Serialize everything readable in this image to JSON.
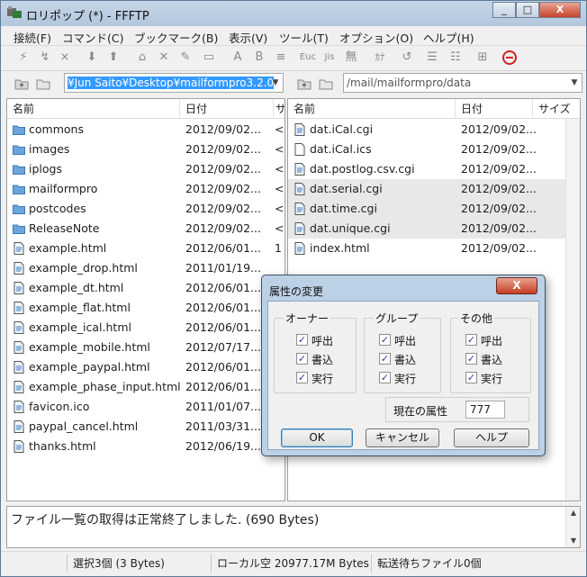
{
  "window": {
    "title": "ロリポップ (*) - FFFTP",
    "minimize_label": "_",
    "maximize_label": "□",
    "close_label": "X"
  },
  "menu": {
    "items": [
      "接続(F)",
      "コマンド(C)",
      "ブックマーク(B)",
      "表示(V)",
      "ツール(T)",
      "オプション(O)",
      "ヘルプ(H)"
    ]
  },
  "toolbar": {
    "icons": [
      "connect-icon",
      "quick-connect-icon",
      "disconnect-icon",
      "download-icon",
      "upload-icon",
      "home-icon",
      "delete-icon",
      "rename-icon",
      "mkdir-icon",
      "ascii-mode-icon",
      "binary-mode-icon",
      "auto-mode-icon",
      "euc-icon",
      "jis-icon",
      "no-convert-icon",
      "kana-icon",
      "refresh-icon",
      "list-view-icon",
      "detail-view-icon",
      "sync-icon",
      "stop-icon"
    ],
    "glyphs": {
      "ascii": "A",
      "binary": "B",
      "auto": "≡",
      "euc": "Euc",
      "jis": "Jis",
      "none": "無",
      "kana": "ｶﾅ"
    }
  },
  "local": {
    "path": "¥Jun Saito¥Desktop¥mailformpro3.2.0",
    "headers": {
      "name": "名前",
      "date": "日付",
      "size": "サ"
    },
    "files": [
      {
        "name": "commons",
        "date": "2012/09/02...",
        "size": "<",
        "type": "folder"
      },
      {
        "name": "images",
        "date": "2012/09/02...",
        "size": "<",
        "type": "folder"
      },
      {
        "name": "iplogs",
        "date": "2012/09/02...",
        "size": "<",
        "type": "folder"
      },
      {
        "name": "mailformpro",
        "date": "2012/09/02...",
        "size": "<",
        "type": "folder"
      },
      {
        "name": "postcodes",
        "date": "2012/09/02...",
        "size": "<",
        "type": "folder"
      },
      {
        "name": "ReleaseNote",
        "date": "2012/09/02...",
        "size": "<",
        "type": "folder"
      },
      {
        "name": "example.html",
        "date": "2012/06/01...",
        "size": "1",
        "type": "file"
      },
      {
        "name": "example_drop.html",
        "date": "2011/01/19...",
        "size": "",
        "type": "file"
      },
      {
        "name": "example_dt.html",
        "date": "2012/06/01...",
        "size": "",
        "type": "file"
      },
      {
        "name": "example_flat.html",
        "date": "2012/06/01...",
        "size": "",
        "type": "file"
      },
      {
        "name": "example_ical.html",
        "date": "2012/06/01...",
        "size": "",
        "type": "file"
      },
      {
        "name": "example_mobile.html",
        "date": "2012/07/17...",
        "size": "",
        "type": "file"
      },
      {
        "name": "example_paypal.html",
        "date": "2012/06/01...",
        "size": "",
        "type": "file"
      },
      {
        "name": "example_phase_input.html",
        "date": "2012/06/01...",
        "size": "",
        "type": "file"
      },
      {
        "name": "favicon.ico",
        "date": "2011/01/07...",
        "size": "",
        "type": "file"
      },
      {
        "name": "paypal_cancel.html",
        "date": "2011/03/31...",
        "size": "",
        "type": "file"
      },
      {
        "name": "thanks.html",
        "date": "2012/06/19...",
        "size": "",
        "type": "file"
      }
    ]
  },
  "remote": {
    "path": "/mail/mailformpro/data",
    "headers": {
      "name": "名前",
      "date": "日付",
      "size": "サイズ"
    },
    "files": [
      {
        "name": "dat.iCal.cgi",
        "date": "2012/09/02...",
        "type": "cgi",
        "selected": false
      },
      {
        "name": "dat.iCal.ics",
        "date": "2012/09/02...",
        "type": "blank",
        "selected": false
      },
      {
        "name": "dat.postlog.csv.cgi",
        "date": "2012/09/02...",
        "type": "cgi",
        "selected": false
      },
      {
        "name": "dat.serial.cgi",
        "date": "2012/09/02...",
        "type": "cgi",
        "selected": true
      },
      {
        "name": "dat.time.cgi",
        "date": "2012/09/02...",
        "type": "cgi",
        "selected": true
      },
      {
        "name": "dat.unique.cgi",
        "date": "2012/09/02...",
        "type": "cgi",
        "selected": true
      },
      {
        "name": "index.html",
        "date": "2012/09/02...",
        "type": "file",
        "selected": false
      }
    ]
  },
  "dialog": {
    "title": "属性の変更",
    "close_label": "X",
    "groups": [
      {
        "title": "オーナー",
        "read": "呼出",
        "write": "書込",
        "exec": "実行"
      },
      {
        "title": "グループ",
        "read": "呼出",
        "write": "書込",
        "exec": "実行"
      },
      {
        "title": "その他",
        "read": "呼出",
        "write": "書込",
        "exec": "実行"
      }
    ],
    "check_mark": "✓",
    "current_attr_label": "現在の属性",
    "current_attr_value": "777",
    "ok_label": "OK",
    "cancel_label": "キャンセル",
    "help_label": "ヘルプ"
  },
  "log": {
    "text": "ファイル一覧の取得は正常終了しました. (690 Bytes)"
  },
  "status": {
    "selection": "選択3個 (3 Bytes)",
    "local_free": "ローカル空 20977.17M Bytes",
    "queue": "転送待ちファイル0個"
  },
  "colors": {
    "accent": "#3399ff",
    "folder": "#4a8ccc",
    "title_bar": "#c5d5e7"
  }
}
